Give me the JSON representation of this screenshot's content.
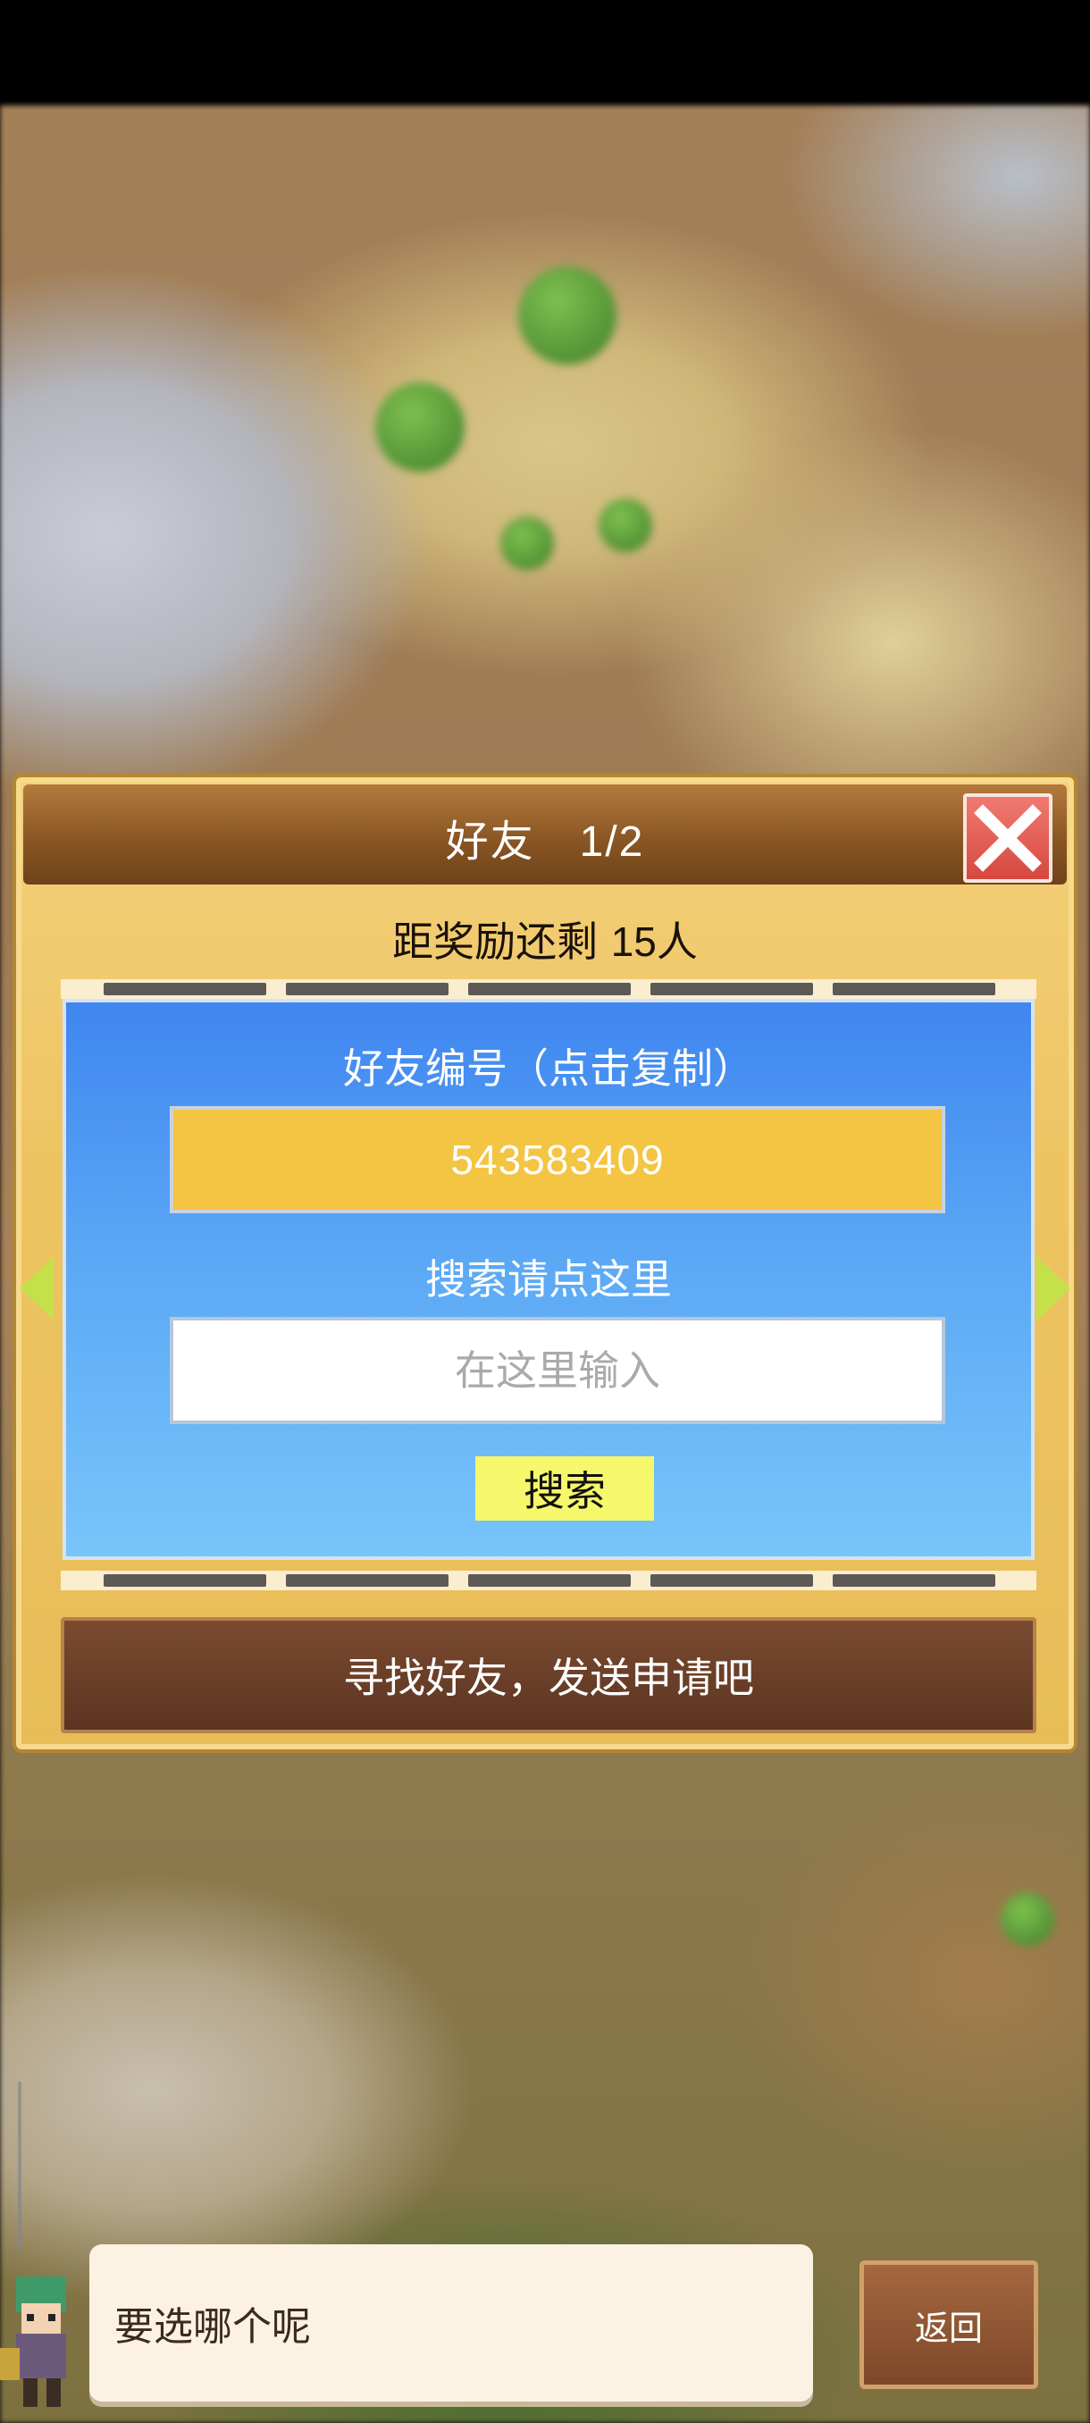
{
  "dialog": {
    "title": "好友",
    "pager": "1/2",
    "reward_text_prefix": "距奖励还剩 ",
    "reward_count": "15",
    "reward_text_suffix": "人"
  },
  "friend_code": {
    "label": "好友编号（点击复制）",
    "value": "543583409"
  },
  "search": {
    "label": "搜索请点这里",
    "placeholder": "在这里输入",
    "button_label": "搜索"
  },
  "find_friend_button": "寻找好友，发送申请吧",
  "assistant": {
    "message": "要选哪个呢"
  },
  "return_button": "返回",
  "colors": {
    "header_brown": "#8a5624",
    "panel_gold": "#eec462",
    "friend_code_bg": "#f4c443",
    "search_button_bg": "#f6f76a",
    "close_red": "#d6483f",
    "arrow_green": "#c6e04a"
  }
}
